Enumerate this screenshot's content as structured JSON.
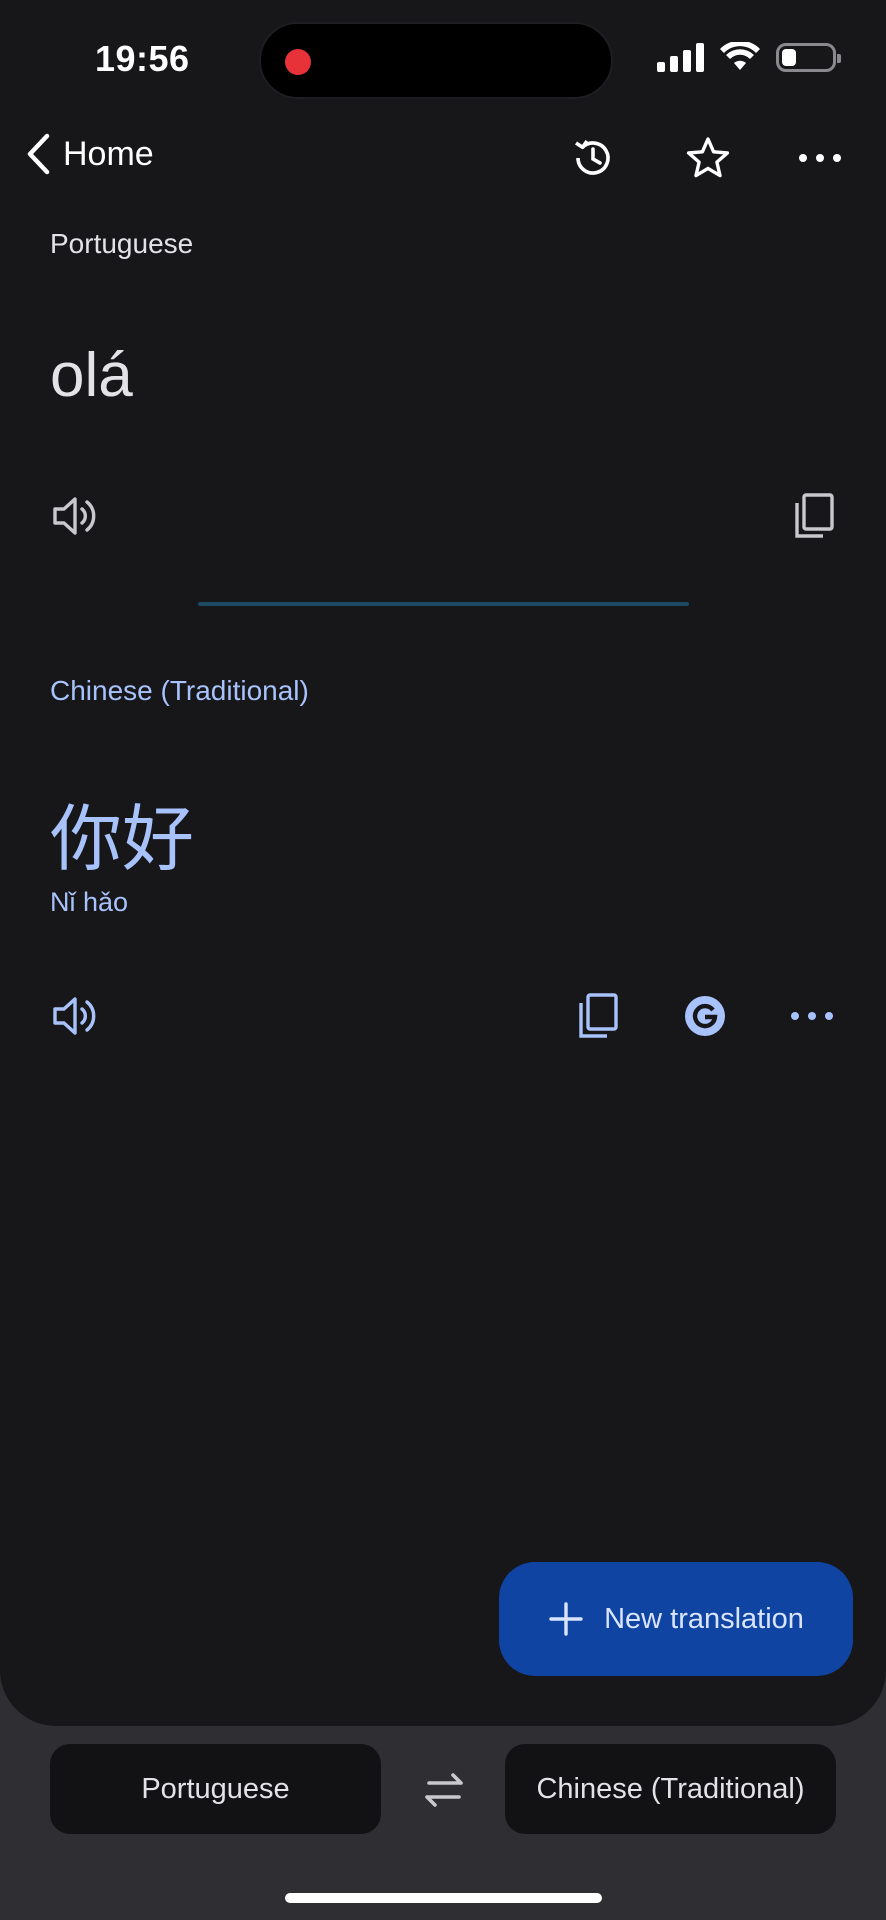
{
  "status_bar": {
    "time": "19:56",
    "battery_level": 0.3
  },
  "top_bar": {
    "back_label": "Home"
  },
  "source": {
    "language": "Portuguese",
    "text": "olá"
  },
  "target": {
    "language": "Chinese (Traditional)",
    "text": "你好",
    "romanization": "Nǐ hǎo"
  },
  "fab": {
    "label": "New translation"
  },
  "language_bar": {
    "source_language": "Portuguese",
    "target_language": "Chinese (Traditional)"
  },
  "colors": {
    "accent": "#a8c3fb",
    "fab_background": "#0f44a2",
    "background": "#171619"
  },
  "icons": [
    "back-chevron-icon",
    "history-icon",
    "star-icon",
    "more-icon",
    "speaker-icon",
    "copy-icon",
    "google-icon",
    "plus-icon",
    "swap-icon"
  ]
}
